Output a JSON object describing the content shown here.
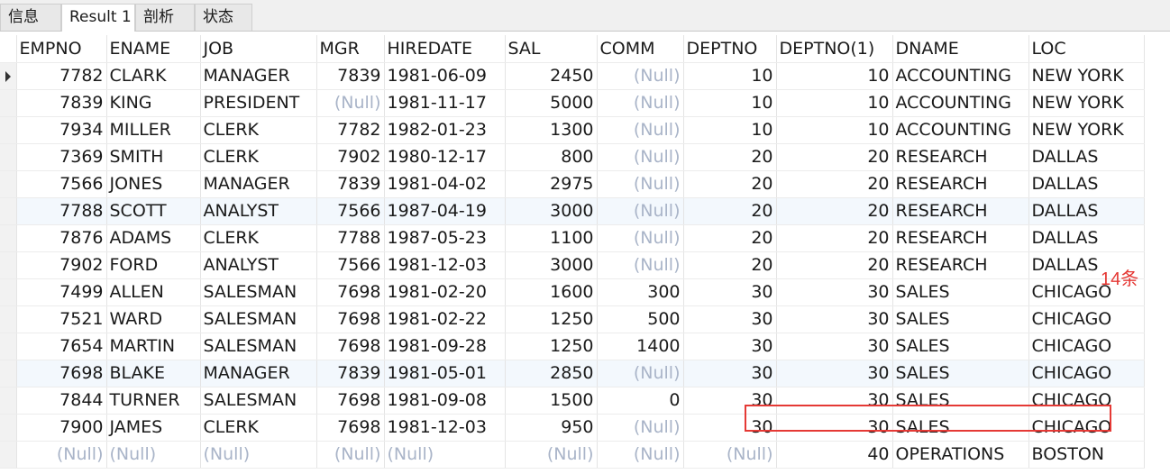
{
  "tabs": [
    "信息",
    "Result 1",
    "剖析",
    "状态"
  ],
  "columns": [
    "EMPNO",
    "ENAME",
    "JOB",
    "MGR",
    "HIREDATE",
    "SAL",
    "COMM",
    "DEPTNO",
    "DEPTNO(1)",
    "DNAME",
    "LOC"
  ],
  "rows": [
    [
      "7782",
      "CLARK",
      "MANAGER",
      "7839",
      "1981-06-09",
      "2450",
      "(Null)",
      "10",
      "10",
      "ACCOUNTING",
      "NEW YORK"
    ],
    [
      "7839",
      "KING",
      "PRESIDENT",
      "(Null)",
      "1981-11-17",
      "5000",
      "(Null)",
      "10",
      "10",
      "ACCOUNTING",
      "NEW YORK"
    ],
    [
      "7934",
      "MILLER",
      "CLERK",
      "7782",
      "1982-01-23",
      "1300",
      "(Null)",
      "10",
      "10",
      "ACCOUNTING",
      "NEW YORK"
    ],
    [
      "7369",
      "SMITH",
      "CLERK",
      "7902",
      "1980-12-17",
      "800",
      "(Null)",
      "20",
      "20",
      "RESEARCH",
      "DALLAS"
    ],
    [
      "7566",
      "JONES",
      "MANAGER",
      "7839",
      "1981-04-02",
      "2975",
      "(Null)",
      "20",
      "20",
      "RESEARCH",
      "DALLAS"
    ],
    [
      "7788",
      "SCOTT",
      "ANALYST",
      "7566",
      "1987-04-19",
      "3000",
      "(Null)",
      "20",
      "20",
      "RESEARCH",
      "DALLAS"
    ],
    [
      "7876",
      "ADAMS",
      "CLERK",
      "7788",
      "1987-05-23",
      "1100",
      "(Null)",
      "20",
      "20",
      "RESEARCH",
      "DALLAS"
    ],
    [
      "7902",
      "FORD",
      "ANALYST",
      "7566",
      "1981-12-03",
      "3000",
      "(Null)",
      "20",
      "20",
      "RESEARCH",
      "DALLAS"
    ],
    [
      "7499",
      "ALLEN",
      "SALESMAN",
      "7698",
      "1981-02-20",
      "1600",
      "300",
      "30",
      "30",
      "SALES",
      "CHICAGO"
    ],
    [
      "7521",
      "WARD",
      "SALESMAN",
      "7698",
      "1981-02-22",
      "1250",
      "500",
      "30",
      "30",
      "SALES",
      "CHICAGO"
    ],
    [
      "7654",
      "MARTIN",
      "SALESMAN",
      "7698",
      "1981-09-28",
      "1250",
      "1400",
      "30",
      "30",
      "SALES",
      "CHICAGO"
    ],
    [
      "7698",
      "BLAKE",
      "MANAGER",
      "7839",
      "1981-05-01",
      "2850",
      "(Null)",
      "30",
      "30",
      "SALES",
      "CHICAGO"
    ],
    [
      "7844",
      "TURNER",
      "SALESMAN",
      "7698",
      "1981-09-08",
      "1500",
      "0",
      "30",
      "30",
      "SALES",
      "CHICAGO"
    ],
    [
      "7900",
      "JAMES",
      "CLERK",
      "7698",
      "1981-12-03",
      "950",
      "(Null)",
      "30",
      "30",
      "SALES",
      "CHICAGO"
    ],
    [
      "(Null)",
      "(Null)",
      "(Null)",
      "(Null)",
      "(Null)",
      "(Null)",
      "(Null)",
      "(Null)",
      "40",
      "OPERATIONS",
      "BOSTON"
    ]
  ],
  "annotation": "14条",
  "colors": {
    "highlight": "#e53935",
    "null_text": "#a9b4c8",
    "band_row": "#f3f8fd"
  }
}
